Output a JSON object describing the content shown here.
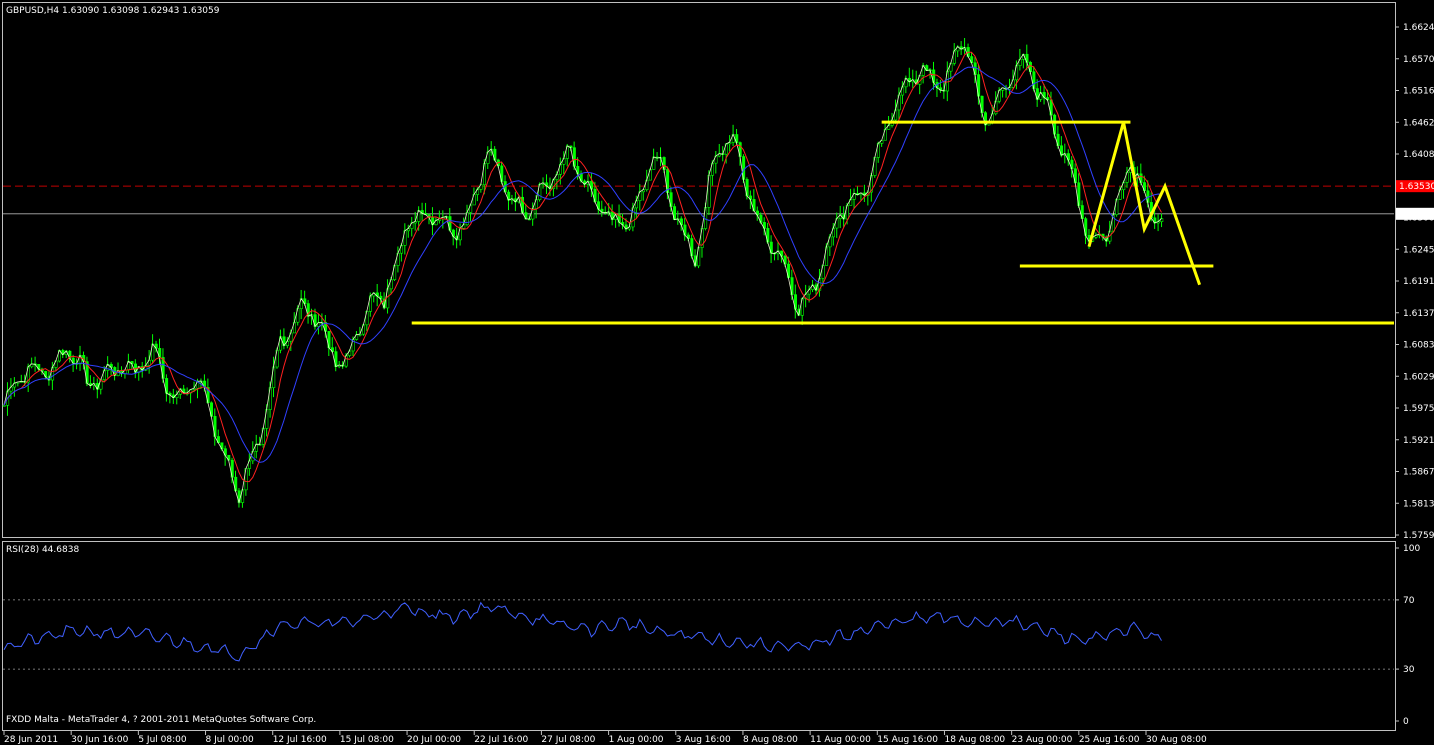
{
  "header": {
    "symbol_info": "GBPUSD,H4  1.63090 1.63098 1.62943 1.63059",
    "rsi_label": "RSI(28) 44.6838",
    "footer": "FXDD Malta - MetaTrader 4, ? 2001-2011 MetaQuotes Software Corp."
  },
  "colors": {
    "background": "#000000",
    "frame": "#c0c0c0",
    "candle": "#00ff00",
    "ma_fast": "#ffffe0",
    "ma_mid": "#ff2020",
    "ma_slow": "#3040ff",
    "trend": "#ffff00",
    "rsi": "#4060ff",
    "bid_line": "#c00000",
    "bid_box": "#ff0000"
  },
  "chart_data": [
    {
      "type": "candlestick",
      "symbol": "GBPUSD",
      "timeframe": "H4",
      "ylim": [
        1.5759,
        1.6624
      ],
      "price_ticks": [
        "1.66240",
        "1.65705",
        "1.65165",
        "1.64625",
        "1.64085",
        "1.63545",
        "1.63005",
        "1.62455",
        "1.61910",
        "1.61370",
        "1.60830",
        "1.60290",
        "1.59750",
        "1.59210",
        "1.58670",
        "1.58130",
        "1.57590"
      ],
      "current_price_label": "1.63059",
      "bid_marker_label": "1.63530",
      "bid_level": 1.6353,
      "current_level": 1.63059,
      "time_ticks": [
        "28 Jun 2011",
        "30 Jun 16:00",
        "5 Jul 08:00",
        "8 Jul 00:00",
        "12 Jul 16:00",
        "15 Jul 08:00",
        "20 Jul 00:00",
        "22 Jul 16:00",
        "27 Jul 08:00",
        "1 Aug 00:00",
        "3 Aug 16:00",
        "8 Aug 08:00",
        "11 Aug 00:00",
        "15 Aug 16:00",
        "18 Aug 08:00",
        "23 Aug 00:00",
        "25 Aug 16:00",
        "30 Aug 08:00"
      ],
      "close_path": [
        [
          0,
          1.598
        ],
        [
          10,
          1.605
        ],
        [
          18,
          1.607
        ],
        [
          24,
          1.601
        ],
        [
          31,
          1.606
        ],
        [
          38,
          1.602
        ],
        [
          44,
          1.608
        ],
        [
          50,
          1.599
        ],
        [
          56,
          1.601
        ],
        [
          62,
          1.594
        ],
        [
          68,
          1.583
        ],
        [
          74,
          1.59
        ],
        [
          80,
          1.611
        ],
        [
          86,
          1.614
        ],
        [
          92,
          1.61
        ],
        [
          98,
          1.606
        ],
        [
          104,
          1.612
        ],
        [
          110,
          1.616
        ],
        [
          116,
          1.63
        ],
        [
          122,
          1.629
        ],
        [
          128,
          1.629
        ],
        [
          134,
          1.631
        ],
        [
          140,
          1.639
        ],
        [
          146,
          1.635
        ],
        [
          152,
          1.632
        ],
        [
          158,
          1.634
        ],
        [
          164,
          1.643
        ],
        [
          170,
          1.633
        ],
        [
          176,
          1.627
        ],
        [
          182,
          1.632
        ],
        [
          188,
          1.64
        ],
        [
          194,
          1.63
        ],
        [
          200,
          1.625
        ],
        [
          206,
          1.64
        ],
        [
          212,
          1.642
        ],
        [
          218,
          1.631
        ],
        [
          224,
          1.622
        ],
        [
          230,
          1.615
        ],
        [
          236,
          1.622
        ],
        [
          242,
          1.629
        ],
        [
          248,
          1.635
        ],
        [
          254,
          1.643
        ],
        [
          260,
          1.65
        ],
        [
          266,
          1.657
        ],
        [
          272,
          1.652
        ],
        [
          278,
          1.659
        ],
        [
          284,
          1.648
        ],
        [
          290,
          1.652
        ],
        [
          296,
          1.655
        ],
        [
          302,
          1.651
        ],
        [
          308,
          1.637
        ],
        [
          314,
          1.626
        ],
        [
          320,
          1.63
        ],
        [
          326,
          1.638
        ],
        [
          332,
          1.631
        ]
      ],
      "moving_averages": [
        {
          "key": "ma_mid",
          "period": 6
        },
        {
          "key": "ma_slow",
          "period": 14
        }
      ],
      "annotations": {
        "support_level": 1.612,
        "resistance_level": 1.6462,
        "target_level": 1.6217,
        "projection": [
          [
            314,
            1.625
          ],
          [
            324,
            1.6462
          ],
          [
            330,
            1.628
          ],
          [
            336,
            1.6353
          ],
          [
            346,
            1.6185
          ]
        ]
      },
      "bar_count": 336
    },
    {
      "type": "line",
      "name": "RSI(28)",
      "ylim": [
        0,
        100
      ],
      "y_ticks": [
        "100",
        "70",
        "30",
        "0"
      ],
      "levels": [
        70,
        30
      ],
      "last_value": 44.6838,
      "rsi_path": [
        [
          0,
          43
        ],
        [
          20,
          52
        ],
        [
          40,
          50
        ],
        [
          60,
          42
        ],
        [
          68,
          38
        ],
        [
          80,
          56
        ],
        [
          100,
          57
        ],
        [
          116,
          65
        ],
        [
          130,
          60
        ],
        [
          140,
          66
        ],
        [
          150,
          61
        ],
        [
          160,
          56
        ],
        [
          170,
          53
        ],
        [
          180,
          57
        ],
        [
          190,
          51
        ],
        [
          200,
          49
        ],
        [
          210,
          46
        ],
        [
          220,
          44
        ],
        [
          230,
          42
        ],
        [
          240,
          48
        ],
        [
          250,
          53
        ],
        [
          260,
          58
        ],
        [
          270,
          60
        ],
        [
          280,
          57
        ],
        [
          290,
          58
        ],
        [
          300,
          53
        ],
        [
          310,
          47
        ],
        [
          320,
          49
        ],
        [
          326,
          54
        ],
        [
          336,
          46
        ]
      ]
    }
  ]
}
